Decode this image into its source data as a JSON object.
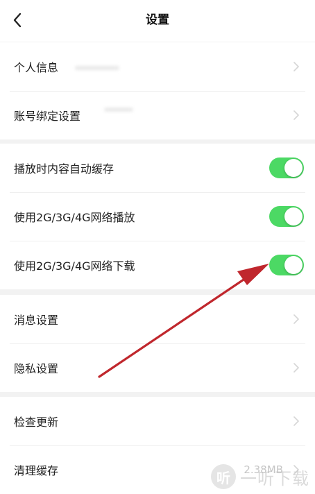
{
  "header": {
    "title": "设置",
    "back_icon": "chevron-left-icon"
  },
  "groups": {
    "account": {
      "items": [
        {
          "label": "个人信息"
        },
        {
          "label": "账号绑定设置"
        }
      ]
    },
    "network": {
      "items": [
        {
          "label": "播放时内容自动缓存",
          "enabled": true
        },
        {
          "label": "使用2G/3G/4G网络播放",
          "enabled": true
        },
        {
          "label": "使用2G/3G/4G网络下载",
          "enabled": true
        }
      ]
    },
    "privacy": {
      "items": [
        {
          "label": "消息设置"
        },
        {
          "label": "隐私设置"
        }
      ]
    },
    "system": {
      "items": [
        {
          "label": "检查更新"
        },
        {
          "label": "清理缓存",
          "value": "2.38MB"
        }
      ]
    }
  },
  "colors": {
    "toggle_on": "#4cd964",
    "annotation_arrow": "#c0272d",
    "background": "#f2f2f2"
  },
  "watermark": {
    "text": "一听下载",
    "logo_glyph": "听"
  }
}
